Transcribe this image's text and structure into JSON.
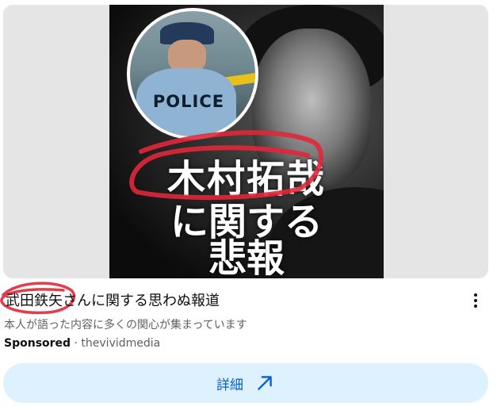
{
  "thumbnail": {
    "badge_text": "POLICE",
    "overlay_line1": "木村拓哉",
    "overlay_line2": "に関する",
    "overlay_line3": "悲報"
  },
  "ad": {
    "title": "武田鉄矢さんに関する思わぬ報道",
    "description": "本人が語った内容に多くの関心が集まっています",
    "sponsored_label": "Sponsored",
    "separator": "·",
    "advertiser": "thevividmedia",
    "cta_label": "詳細"
  },
  "icons": {
    "more": "more-vert-icon",
    "cta": "arrow-up-right-icon"
  },
  "colors": {
    "cta_background": "#def1ff",
    "cta_text": "#065fd4",
    "scribble": "#e0283a"
  }
}
